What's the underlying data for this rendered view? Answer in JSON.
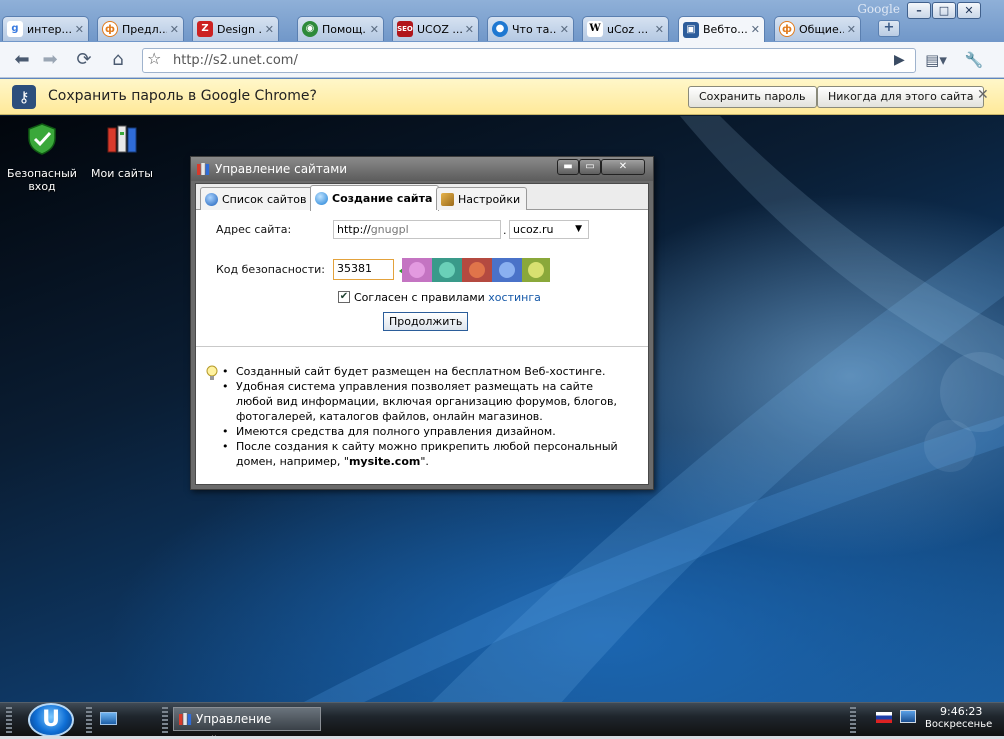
{
  "browser": {
    "brand_label": "Google",
    "tabs": [
      {
        "label": "интер...",
        "icon": "google-icon"
      },
      {
        "label": "Предл...",
        "icon": "ucoz-icon"
      },
      {
        "label": "Design ...",
        "icon": "design-icon"
      },
      {
        "label": "Помощ...",
        "icon": "globe-icon"
      },
      {
        "label": "UCOZ ...",
        "icon": "seo-icon"
      },
      {
        "label": "Что та...",
        "icon": "earth-icon"
      },
      {
        "label": "uCoz ...",
        "icon": "wikipedia-icon"
      },
      {
        "label": "Вебто...",
        "icon": "webtop-icon"
      },
      {
        "label": "Общие...",
        "icon": "ucoz-icon"
      }
    ],
    "new_tab_label": "+",
    "url": "http://s2.unet.com/",
    "colors": {
      "accent": "#6f96c8",
      "infobar": "#ffe99a"
    }
  },
  "infobar": {
    "text": "Сохранить пароль в Google Chrome?",
    "save_button": "Сохранить пароль",
    "never_button": "Никогда для этого сайта",
    "close_glyph": "✕"
  },
  "desktop": {
    "icons": [
      {
        "label": "Безопасный вход",
        "icon": "shield-check-icon"
      },
      {
        "label": "Мои сайты",
        "icon": "folders-icon"
      }
    ]
  },
  "window": {
    "title": "Управление сайтами",
    "tabs": [
      {
        "label": "Список сайтов",
        "active": false
      },
      {
        "label": "Создание сайта",
        "active": true
      },
      {
        "label": "Настройки",
        "active": false
      }
    ],
    "form": {
      "address_label": "Адрес сайта:",
      "address_prefix": "http://",
      "address_value": "gnugpl",
      "dot": ".",
      "domain_selected": "ucoz.ru",
      "security_label": "Код безопасности:",
      "security_value": "35381",
      "agree_checked": true,
      "agree_text": "Согласен с правилами ",
      "agree_link": "хостинга",
      "continue_button": "Продолжить"
    },
    "info": [
      "Созданный сайт будет размещен на бесплатном Веб-хостинге.",
      "Удобная система управления позволяет размещать на сайте любой вид информации, включая организацию форумов, блогов, фотогалерей, каталогов файлов, онлайн магазинов.",
      "Имеются средства для полного управления дизайном."
    ],
    "info_last_prefix": "После создания к сайту можно прикрепить любой персональный домен, например, \"",
    "info_last_bold": "mysite.com",
    "info_last_suffix": "\"."
  },
  "taskbar": {
    "start_label": "U",
    "task_button": "Управление сайтами",
    "time": "9:46:23",
    "day": "Воскресенье"
  }
}
